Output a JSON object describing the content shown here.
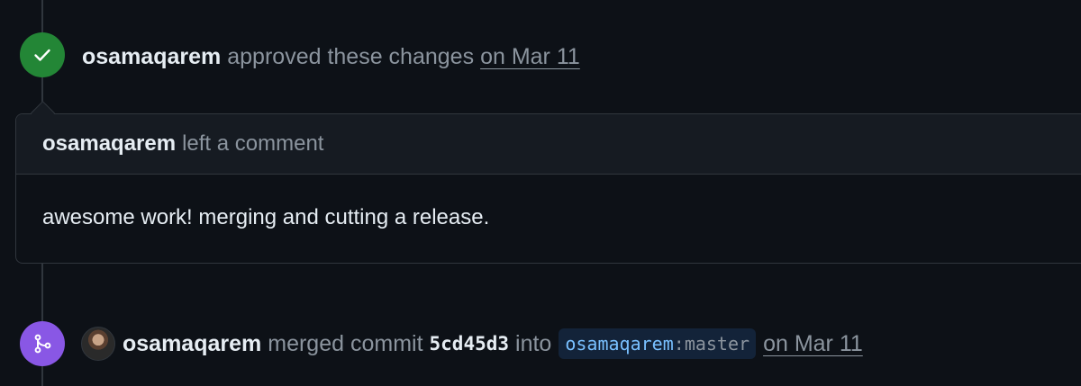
{
  "approval": {
    "author": "osamaqarem",
    "action": "approved these changes",
    "date": "on Mar 11",
    "icon": "check-icon",
    "badge_color": "#238636"
  },
  "comment": {
    "author": "osamaqarem",
    "action": "left a comment",
    "body": "awesome work! merging and cutting a release."
  },
  "merge": {
    "author": "osamaqarem",
    "action": "merged commit",
    "commit_sha": "5cd45d3",
    "into_label": "into",
    "branch_owner": "osamaqarem",
    "branch_separator": ":",
    "branch_name": "master",
    "date": "on Mar 11",
    "icon": "git-merge-icon",
    "badge_color": "#8957e5"
  },
  "colors": {
    "background": "#0d1117",
    "muted_text": "#8b949e",
    "primary_text": "#e6edf3",
    "border": "#30363d",
    "link_blue": "#79c0ff"
  }
}
